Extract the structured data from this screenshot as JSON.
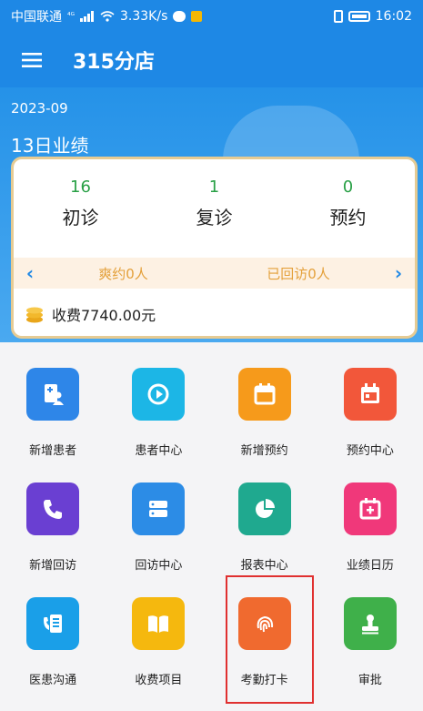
{
  "status": {
    "carrier": "中国联通",
    "net": "⁴ᴳ",
    "speed": "3.33K/s",
    "time": "16:02"
  },
  "header": {
    "title": "315分店"
  },
  "summary": {
    "month": "2023-09",
    "day_title": "13日业绩",
    "stats": [
      {
        "value": "16",
        "label": "初诊"
      },
      {
        "value": "1",
        "label": "复诊"
      },
      {
        "value": "0",
        "label": "预约"
      }
    ],
    "missed": "爽约0人",
    "revisited": "已回访0人",
    "fee": "收费7740.00元"
  },
  "grid": [
    {
      "label": "新增患者",
      "icon": "add-patient-icon",
      "color": "#2e86e8"
    },
    {
      "label": "患者中心",
      "icon": "play-circle-icon",
      "color": "#1cb6e6"
    },
    {
      "label": "新增预约",
      "icon": "calendar-icon",
      "color": "#f69a1b"
    },
    {
      "label": "预约中心",
      "icon": "calendar-grid-icon",
      "color": "#f2573a"
    },
    {
      "label": "新增回访",
      "icon": "phone-icon",
      "color": "#6a3fd2"
    },
    {
      "label": "回访中心",
      "icon": "server-icon",
      "color": "#2c8ce6"
    },
    {
      "label": "报表中心",
      "icon": "pie-chart-icon",
      "color": "#1fa98f"
    },
    {
      "label": "业绩日历",
      "icon": "calendar-plus-icon",
      "color": "#f0387a"
    },
    {
      "label": "医患沟通",
      "icon": "phone-book-icon",
      "color": "#1a9fe8"
    },
    {
      "label": "收费项目",
      "icon": "book-icon",
      "color": "#f5b80e"
    },
    {
      "label": "考勤打卡",
      "icon": "fingerprint-icon",
      "color": "#f06a2f"
    },
    {
      "label": "审批",
      "icon": "stamp-icon",
      "color": "#3fb04a"
    }
  ]
}
